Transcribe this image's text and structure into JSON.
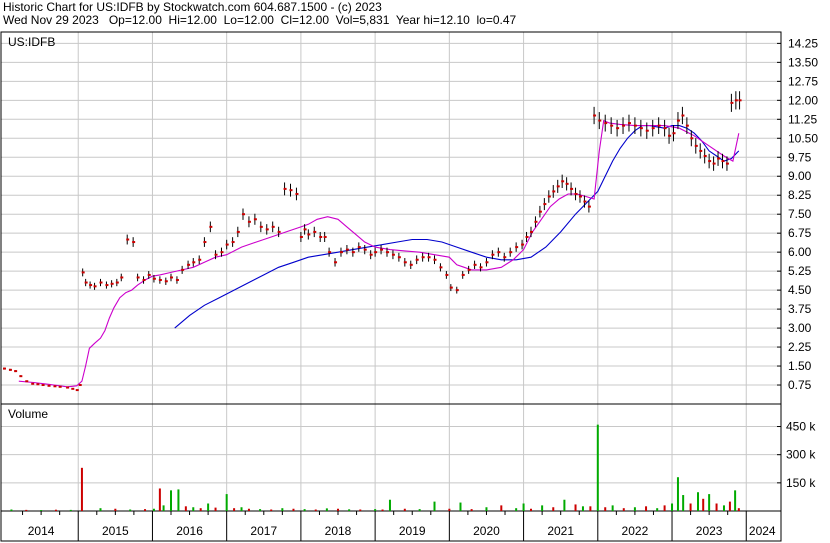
{
  "header": {
    "line1": "Historic Chart for US:IDFB by Stockwatch.com 604.687.1500 - (c) 2023",
    "line2": "Wed Nov 29 2023   Op=12.00  Hi=12.00  Lo=12.00  Cl=12.00  Vol=5,831  Year hi=12.10  lo=0.47"
  },
  "chart_data": {
    "type": "line",
    "symbol_label": "US:IDFB",
    "volume_label": "Volume",
    "x_range": [
      2014.0,
      2024.32
    ],
    "price_axis": {
      "ylim": [
        0,
        14.7
      ],
      "ticks": [
        0.75,
        1.5,
        2.25,
        3.0,
        3.75,
        4.5,
        5.25,
        6.0,
        6.75,
        7.5,
        8.25,
        9.0,
        9.75,
        10.5,
        11.25,
        12.0,
        12.75,
        13.5,
        14.25
      ],
      "tick_labels": [
        "0.75",
        "1.50",
        "2.25",
        "3.00",
        "3.75",
        "4.50",
        "5.25",
        "6.00",
        "6.75",
        "7.50",
        "8.25",
        "9.00",
        "9.75",
        "10.50",
        "11.25",
        "12.00",
        "12.75",
        "13.50",
        "14.25"
      ]
    },
    "volume_axis": {
      "ylim": [
        0,
        570000
      ],
      "ticks": [
        150000,
        300000,
        450000
      ],
      "tick_labels": [
        "150 k",
        "300 k",
        "450 k"
      ]
    },
    "x_axis": {
      "ticks": [
        2014,
        2015,
        2016,
        2017,
        2018,
        2019,
        2020,
        2021,
        2022,
        2023,
        2024
      ],
      "tick_labels": [
        "2014",
        "2015",
        "2016",
        "2017",
        "2018",
        "2019",
        "2020",
        "2021",
        "2022",
        "2023",
        "2024"
      ]
    },
    "colors": {
      "price": "#cc0000",
      "bar": "#000000",
      "ma_short": "#cc00cc",
      "ma_long": "#0000cc",
      "vol_up": "#00aa00",
      "vol_down": "#cc0000",
      "grid": "#c8c8c8"
    },
    "grid": true,
    "series": [
      {
        "key": "price",
        "x": [
          2014.0,
          2014.08,
          2014.15,
          2014.22,
          2014.3,
          2014.38,
          2014.45,
          2014.52,
          2014.6,
          2014.68,
          2014.75,
          2014.85,
          2014.92,
          2014.98,
          2015.02,
          2015.06,
          2015.1,
          2015.16,
          2015.22,
          2015.3,
          2015.38,
          2015.45,
          2015.52,
          2015.58,
          2015.66,
          2015.74,
          2015.8,
          2015.88,
          2015.95,
          2016.02,
          2016.1,
          2016.18,
          2016.25,
          2016.33,
          2016.4,
          2016.48,
          2016.55,
          2016.63,
          2016.7,
          2016.78,
          2016.85,
          2016.93,
          2017.0,
          2017.08,
          2017.15,
          2017.22,
          2017.3,
          2017.38,
          2017.46,
          2017.54,
          2017.62,
          2017.7,
          2017.78,
          2017.86,
          2017.94,
          2018.0,
          2018.05,
          2018.1,
          2018.18,
          2018.26,
          2018.32,
          2018.38,
          2018.46,
          2018.54,
          2018.62,
          2018.7,
          2018.78,
          2018.86,
          2018.94,
          2019.0,
          2019.08,
          2019.16,
          2019.24,
          2019.32,
          2019.4,
          2019.48,
          2019.56,
          2019.64,
          2019.72,
          2019.8,
          2019.88,
          2019.96,
          2020.02,
          2020.1,
          2020.18,
          2020.26,
          2020.34,
          2020.42,
          2020.5,
          2020.58,
          2020.66,
          2020.74,
          2020.82,
          2020.9,
          2020.98,
          2021.04,
          2021.1,
          2021.16,
          2021.22,
          2021.28,
          2021.34,
          2021.4,
          2021.46,
          2021.52,
          2021.58,
          2021.64,
          2021.7,
          2021.76,
          2021.82,
          2021.88,
          2021.95,
          2022.02,
          2022.1,
          2022.18,
          2022.26,
          2022.34,
          2022.42,
          2022.5,
          2022.58,
          2022.66,
          2022.74,
          2022.82,
          2022.9,
          2022.96,
          2023.02,
          2023.08,
          2023.14,
          2023.2,
          2023.26,
          2023.32,
          2023.38,
          2023.44,
          2023.5,
          2023.56,
          2023.62,
          2023.68,
          2023.74,
          2023.8,
          2023.86,
          2023.91
        ],
        "values": [
          1.4,
          1.35,
          1.3,
          1.1,
          0.9,
          0.8,
          0.78,
          0.75,
          0.72,
          0.7,
          0.68,
          0.65,
          0.6,
          0.55,
          0.75,
          5.2,
          4.8,
          4.7,
          4.65,
          4.8,
          4.7,
          4.75,
          4.8,
          5.0,
          6.5,
          6.4,
          5.0,
          4.9,
          5.1,
          4.95,
          4.9,
          4.85,
          5.0,
          4.9,
          5.3,
          5.5,
          5.6,
          5.7,
          6.4,
          7.0,
          5.9,
          6.0,
          6.3,
          6.4,
          6.8,
          7.5,
          7.2,
          7.3,
          7.0,
          6.9,
          7.0,
          6.8,
          8.5,
          8.45,
          8.3,
          6.6,
          6.9,
          6.7,
          6.8,
          6.6,
          6.6,
          6.0,
          5.6,
          6.0,
          6.1,
          6.0,
          6.2,
          6.1,
          5.9,
          6.0,
          6.1,
          6.0,
          5.9,
          5.8,
          5.6,
          5.5,
          5.7,
          5.8,
          5.8,
          5.7,
          5.4,
          5.1,
          4.6,
          4.5,
          5.1,
          5.3,
          5.5,
          5.4,
          5.6,
          5.9,
          6.0,
          5.8,
          6.0,
          6.2,
          6.3,
          6.6,
          6.8,
          7.2,
          7.6,
          7.9,
          8.2,
          8.4,
          8.6,
          8.8,
          8.7,
          8.5,
          8.3,
          8.2,
          8.0,
          7.8,
          11.4,
          11.2,
          11.1,
          11.0,
          10.9,
          11.0,
          11.1,
          11.0,
          10.9,
          10.8,
          10.9,
          11.0,
          10.9,
          10.6,
          10.7,
          11.2,
          11.4,
          11.0,
          10.5,
          10.2,
          10.0,
          9.8,
          9.6,
          9.5,
          9.7,
          9.6,
          9.5,
          11.9,
          12.0,
          12.0
        ]
      },
      {
        "key": "ma_short",
        "x": [
          2014.2,
          2014.4,
          2014.6,
          2014.75,
          2014.85,
          2014.92,
          2014.98,
          2015.05,
          2015.1,
          2015.15,
          2015.22,
          2015.3,
          2015.36,
          2015.42,
          2015.48,
          2015.56,
          2015.64,
          2015.72,
          2015.8,
          2015.9,
          2016.0,
          2016.1,
          2016.25,
          2016.4,
          2016.55,
          2016.7,
          2016.85,
          2017.0,
          2017.2,
          2017.4,
          2017.6,
          2017.8,
          2017.9,
          2018.0,
          2018.1,
          2018.22,
          2018.36,
          2018.5,
          2018.62,
          2018.74,
          2018.86,
          2019.0,
          2019.2,
          2019.4,
          2019.6,
          2019.8,
          2020.0,
          2020.1,
          2020.2,
          2020.3,
          2020.5,
          2020.7,
          2020.86,
          2021.0,
          2021.12,
          2021.24,
          2021.36,
          2021.48,
          2021.6,
          2021.72,
          2021.84,
          2021.95,
          2022.02,
          2022.08,
          2022.16,
          2022.3,
          2022.5,
          2022.7,
          2022.9,
          2023.1,
          2023.3,
          2023.5,
          2023.7,
          2023.82,
          2023.9
        ],
        "values": [
          0.9,
          0.85,
          0.78,
          0.72,
          0.68,
          0.7,
          0.72,
          0.9,
          1.5,
          2.2,
          2.4,
          2.6,
          2.9,
          3.4,
          3.8,
          4.2,
          4.4,
          4.5,
          4.7,
          4.9,
          5.05,
          5.1,
          5.2,
          5.3,
          5.4,
          5.6,
          5.8,
          5.9,
          6.2,
          6.4,
          6.6,
          6.8,
          6.9,
          7.0,
          7.1,
          7.3,
          7.4,
          7.3,
          7.0,
          6.7,
          6.4,
          6.2,
          6.1,
          6.05,
          6.0,
          5.9,
          5.8,
          5.5,
          5.4,
          5.3,
          5.3,
          5.4,
          5.7,
          6.1,
          6.8,
          7.3,
          7.8,
          8.1,
          8.3,
          8.3,
          8.2,
          8.1,
          10.0,
          11.2,
          11.1,
          11.05,
          11.0,
          11.0,
          11.0,
          10.9,
          10.6,
          10.2,
          9.8,
          9.6,
          10.7
        ]
      },
      {
        "key": "ma_long",
        "x": [
          2016.3,
          2016.5,
          2016.7,
          2016.9,
          2017.1,
          2017.3,
          2017.5,
          2017.7,
          2017.9,
          2018.1,
          2018.3,
          2018.5,
          2018.7,
          2018.9,
          2019.1,
          2019.3,
          2019.5,
          2019.7,
          2019.9,
          2020.1,
          2020.3,
          2020.5,
          2020.7,
          2020.9,
          2021.1,
          2021.3,
          2021.5,
          2021.7,
          2021.9,
          2022.0,
          2022.1,
          2022.2,
          2022.3,
          2022.4,
          2022.5,
          2022.6,
          2022.7,
          2022.8,
          2022.9,
          2023.0,
          2023.1,
          2023.2,
          2023.3,
          2023.4,
          2023.5,
          2023.6,
          2023.7,
          2023.8,
          2023.9
        ],
        "values": [
          3.0,
          3.5,
          3.9,
          4.2,
          4.5,
          4.8,
          5.1,
          5.4,
          5.6,
          5.8,
          5.9,
          6.0,
          6.1,
          6.2,
          6.3,
          6.4,
          6.5,
          6.5,
          6.4,
          6.2,
          6.0,
          5.8,
          5.7,
          5.7,
          5.8,
          6.2,
          6.8,
          7.5,
          8.1,
          8.4,
          9.0,
          9.6,
          10.1,
          10.5,
          10.8,
          11.0,
          11.0,
          10.95,
          10.9,
          11.0,
          11.0,
          10.9,
          10.7,
          10.4,
          10.0,
          9.8,
          9.6,
          9.7,
          10.0
        ]
      },
      {
        "key": "volume",
        "x": [
          2014.1,
          2014.3,
          2014.5,
          2014.7,
          2014.9,
          2015.05,
          2015.3,
          2015.5,
          2015.7,
          2015.9,
          2016.02,
          2016.1,
          2016.15,
          2016.25,
          2016.35,
          2016.45,
          2016.55,
          2016.65,
          2016.75,
          2016.85,
          2017.0,
          2017.1,
          2017.2,
          2017.3,
          2017.45,
          2017.6,
          2017.75,
          2017.9,
          2018.05,
          2018.2,
          2018.35,
          2018.5,
          2018.65,
          2018.8,
          2019.0,
          2019.1,
          2019.2,
          2019.4,
          2019.6,
          2019.8,
          2020.0,
          2020.15,
          2020.3,
          2020.5,
          2020.7,
          2020.9,
          2021.0,
          2021.1,
          2021.25,
          2021.4,
          2021.55,
          2021.7,
          2021.8,
          2021.9,
          2022.0,
          2022.1,
          2022.2,
          2022.35,
          2022.5,
          2022.65,
          2022.8,
          2022.9,
          2023.0,
          2023.08,
          2023.15,
          2023.25,
          2023.35,
          2023.42,
          2023.5,
          2023.6,
          2023.7,
          2023.78,
          2023.85,
          2023.9
        ],
        "values": [
          8000,
          6000,
          5000,
          7000,
          6000,
          230000,
          15000,
          12000,
          8000,
          10000,
          12000,
          120000,
          30000,
          110000,
          115000,
          25000,
          20000,
          15000,
          40000,
          18000,
          90000,
          15000,
          20000,
          12000,
          10000,
          8000,
          15000,
          12000,
          10000,
          8000,
          14000,
          12000,
          9000,
          8000,
          10000,
          8000,
          60000,
          12000,
          10000,
          50000,
          12000,
          45000,
          10000,
          20000,
          30000,
          15000,
          40000,
          12000,
          30000,
          20000,
          60000,
          35000,
          25000,
          25000,
          460000,
          20000,
          30000,
          15000,
          20000,
          25000,
          15000,
          30000,
          40000,
          180000,
          85000,
          40000,
          100000,
          65000,
          90000,
          40000,
          30000,
          50000,
          110000,
          15000
        ],
        "up": [
          true,
          false,
          true,
          false,
          true,
          false,
          true,
          false,
          true,
          false,
          true,
          false,
          true,
          true,
          true,
          false,
          true,
          false,
          true,
          false,
          true,
          false,
          true,
          false,
          true,
          false,
          true,
          false,
          true,
          false,
          true,
          false,
          true,
          false,
          true,
          false,
          true,
          false,
          true,
          true,
          false,
          true,
          false,
          true,
          false,
          true,
          true,
          false,
          true,
          false,
          true,
          false,
          true,
          false,
          true,
          false,
          true,
          false,
          true,
          false,
          true,
          false,
          true,
          true,
          true,
          false,
          true,
          false,
          true,
          false,
          true,
          false,
          true,
          false
        ]
      }
    ]
  }
}
